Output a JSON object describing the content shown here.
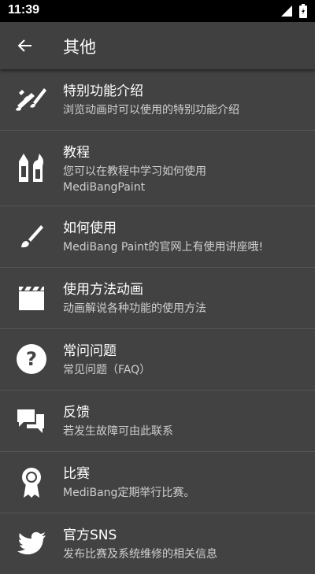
{
  "status": {
    "time": "11:39"
  },
  "app_bar": {
    "title": "其他"
  },
  "items": [
    {
      "icon": "brush-sparkle-icon",
      "title": "特别功能介绍",
      "desc": "浏览动画时可以使用的特别功能介绍"
    },
    {
      "icon": "pens-icon",
      "title": "教程",
      "desc": "您可以在教程中学习如何使用",
      "desc2": "MediBangPaint"
    },
    {
      "icon": "brush-icon",
      "title": "如何使用",
      "desc": "MediBang Paint的官网上有使用讲座哦!"
    },
    {
      "icon": "clapperboard-icon",
      "title": "使用方法动画",
      "desc": "动画解说各种功能的使用方法"
    },
    {
      "icon": "help-circle-icon",
      "title": "常问问题",
      "desc": "常见问题（FAQ）"
    },
    {
      "icon": "chat-bubbles-icon",
      "title": "反馈",
      "desc": "若发生故障可由此联系"
    },
    {
      "icon": "ribbon-award-icon",
      "title": "比赛",
      "desc": "MediBang定期举行比赛。"
    },
    {
      "icon": "twitter-bird-icon",
      "title": "官方SNS",
      "desc": "发布比赛及系统维修的相关信息"
    }
  ]
}
